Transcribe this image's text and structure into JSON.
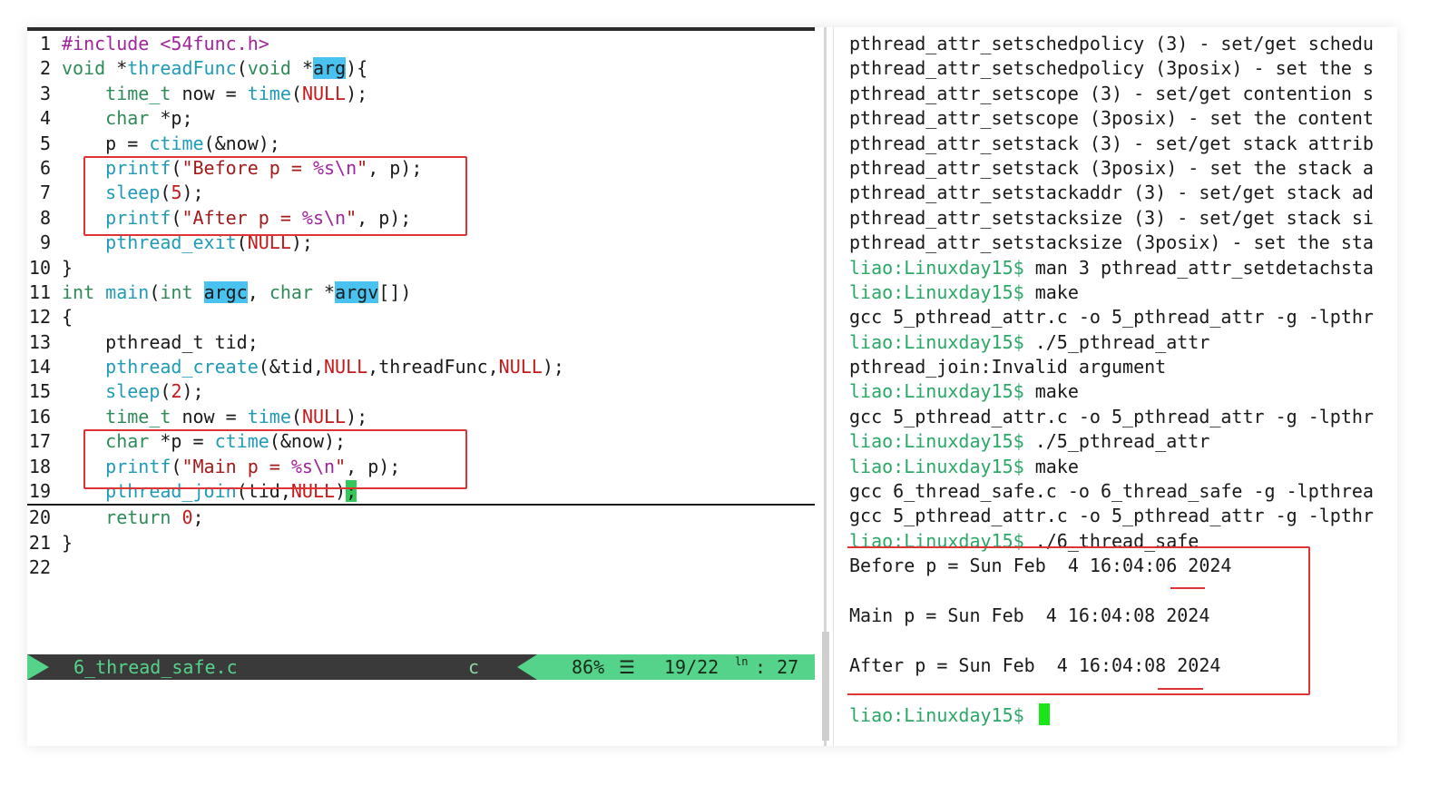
{
  "editor": {
    "lines": [
      {
        "n": "1"
      },
      {
        "n": "2"
      },
      {
        "n": "3"
      },
      {
        "n": "4"
      },
      {
        "n": "5"
      },
      {
        "n": "6"
      },
      {
        "n": "7"
      },
      {
        "n": "8"
      },
      {
        "n": "9"
      },
      {
        "n": "10"
      },
      {
        "n": "11"
      },
      {
        "n": "12"
      },
      {
        "n": "13"
      },
      {
        "n": "14"
      },
      {
        "n": "15"
      },
      {
        "n": "16"
      },
      {
        "n": "17"
      },
      {
        "n": "18"
      },
      {
        "n": "19"
      },
      {
        "n": "20"
      },
      {
        "n": "21"
      },
      {
        "n": "22"
      }
    ],
    "tokens": {
      "l1_a": "#include",
      "l1_b": " <54func.h>",
      "l2_a": "void",
      "l2_b": " *",
      "l2_c": "threadFunc",
      "l2_d": "(",
      "l2_e": "void",
      "l2_f": " *",
      "l2_g": "arg",
      "l2_h": "){",
      "l3_a": "    ",
      "l3_b": "time_t",
      "l3_c": " now = ",
      "l3_d": "time",
      "l3_e": "(",
      "l3_f": "NULL",
      "l3_g": ");",
      "l4_a": "    ",
      "l4_b": "char",
      "l4_c": " *p;",
      "l5_a": "    p = ",
      "l5_b": "ctime",
      "l5_c": "(&now);",
      "l6_a": "    ",
      "l6_b": "printf",
      "l6_c": "(",
      "l6_d": "\"Before p = ",
      "l6_e": "%s\\n",
      "l6_f": "\"",
      "l6_g": ", p);",
      "l7_a": "    ",
      "l7_b": "sleep",
      "l7_c": "(",
      "l7_d": "5",
      "l7_e": ");",
      "l8_a": "    ",
      "l8_b": "printf",
      "l8_c": "(",
      "l8_d": "\"After p = ",
      "l8_e": "%s\\n",
      "l8_f": "\"",
      "l8_g": ", p);",
      "l9_a": "    ",
      "l9_b": "pthread_exit",
      "l9_c": "(",
      "l9_d": "NULL",
      "l9_e": ");",
      "l10_a": "}",
      "l11_a": "int",
      "l11_b": " ",
      "l11_c": "main",
      "l11_d": "(",
      "l11_e": "int",
      "l11_f": " ",
      "l11_g": "argc",
      "l11_h": ", ",
      "l11_i": "char",
      "l11_j": " *",
      "l11_k": "argv",
      "l11_l": "[])",
      "l12_a": "{",
      "l13_a": "    pthread_t tid;",
      "l14_a": "    ",
      "l14_b": "pthread_create",
      "l14_c": "(&tid,",
      "l14_d": "NULL",
      "l14_e": ",threadFunc,",
      "l14_f": "NULL",
      "l14_g": ");",
      "l15_a": "    ",
      "l15_b": "sleep",
      "l15_c": "(",
      "l15_d": "2",
      "l15_e": ");",
      "l16_a": "    ",
      "l16_b": "time_t",
      "l16_c": " now = ",
      "l16_d": "time",
      "l16_e": "(",
      "l16_f": "NULL",
      "l16_g": ");",
      "l17_a": "    ",
      "l17_b": "char",
      "l17_c": " *p = ",
      "l17_d": "ctime",
      "l17_e": "(&now);",
      "l18_a": "    ",
      "l18_b": "printf",
      "l18_c": "(",
      "l18_d": "\"Main p = ",
      "l18_e": "%s\\n",
      "l18_f": "\"",
      "l18_g": ", p);",
      "l19_a": "    ",
      "l19_b": "pthread_join",
      "l19_c": "(tid,",
      "l19_d": "NULL",
      "l19_e": ")",
      "l19_f": ";",
      "l20_a": "    ",
      "l20_b": "return",
      "l20_c": " ",
      "l20_d": "0",
      "l20_e": ";",
      "l21_a": "}"
    },
    "status": {
      "filename": "6_thread_safe.c",
      "filetype": "c",
      "percent": "86%",
      "menu_glyph": "☰",
      "position": "19/22",
      "ln_glyph": "ln",
      "column": ": 27"
    }
  },
  "terminal": {
    "lines": [
      {
        "t": "pthread_attr_setschedpolicy (3) - set/get schedu",
        "p": ""
      },
      {
        "t": "pthread_attr_setschedpolicy (3posix) - set the s",
        "p": ""
      },
      {
        "t": "pthread_attr_setscope (3) - set/get contention s",
        "p": ""
      },
      {
        "t": "pthread_attr_setscope (3posix) - set the content",
        "p": ""
      },
      {
        "t": "pthread_attr_setstack (3) - set/get stack attrib",
        "p": ""
      },
      {
        "t": "pthread_attr_setstack (3posix) - set the stack a",
        "p": ""
      },
      {
        "t": "pthread_attr_setstackaddr (3) - set/get stack ad",
        "p": ""
      },
      {
        "t": "pthread_attr_setstacksize (3) - set/get stack si",
        "p": ""
      },
      {
        "t": "pthread_attr_setstacksize (3posix) - set the sta",
        "p": ""
      },
      {
        "p": "liao:Linuxday15$",
        "t": " man 3 pthread_attr_setdetachsta"
      },
      {
        "p": "liao:Linuxday15$",
        "t": " make"
      },
      {
        "t": "gcc 5_pthread_attr.c -o 5_pthread_attr -g -lpthr",
        "p": ""
      },
      {
        "p": "liao:Linuxday15$",
        "t": " ./5_pthread_attr"
      },
      {
        "t": "pthread_join:Invalid argument",
        "p": ""
      },
      {
        "p": "liao:Linuxday15$",
        "t": " make"
      },
      {
        "t": "gcc 5_pthread_attr.c -o 5_pthread_attr -g -lpthr",
        "p": ""
      },
      {
        "p": "liao:Linuxday15$",
        "t": " ./5_pthread_attr"
      },
      {
        "p": "liao:Linuxday15$",
        "t": " make"
      },
      {
        "t": "gcc 6_thread_safe.c -o 6_thread_safe -g -lpthrea",
        "p": ""
      },
      {
        "t": "gcc 5_pthread_attr.c -o 5_pthread_attr -g -lpthr",
        "p": ""
      },
      {
        "p": "liao:Linuxday15$",
        "t": " ./6_thread_safe"
      },
      {
        "t": "Before p = Sun Feb  4 16:04:06 2024",
        "p": ""
      },
      {
        "t": "",
        "p": ""
      },
      {
        "t": "Main p = Sun Feb  4 16:04:08 2024",
        "p": ""
      },
      {
        "t": "",
        "p": ""
      },
      {
        "t": "After p = Sun Feb  4 16:04:08 2024",
        "p": ""
      },
      {
        "t": "",
        "p": ""
      },
      {
        "p": "liao:Linuxday15$",
        "t": " "
      }
    ]
  }
}
